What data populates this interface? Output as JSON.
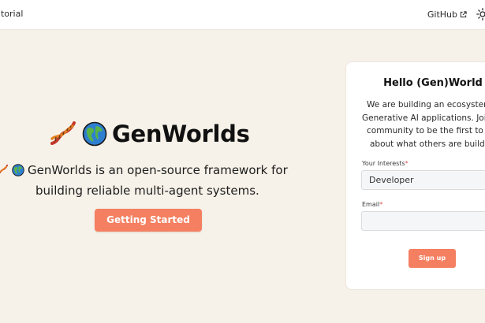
{
  "nav": {
    "left_link": "utorial",
    "github_label": "GitHub",
    "icons": {
      "external": "external-link-icon",
      "theme": "sun-icon"
    }
  },
  "hero": {
    "title": "GenWorlds",
    "desc_line1": "GenWorlds is an open-source framework for",
    "desc_line2": "building reliable multi-agent systems.",
    "cta_label": "Getting Started",
    "icons": [
      "dna-icon",
      "globe-icon"
    ]
  },
  "card": {
    "title": "Hello (Gen)World",
    "text_lines": [
      "We are building an ecosystem",
      "Generative AI applications. Join",
      "community to be the first to lea",
      "about what others are buildin"
    ],
    "interests_label": "Your Interests",
    "interests_value": "Developer",
    "email_label": "Email",
    "email_value": "",
    "required_mark": "*",
    "signup_label": "Sign up"
  },
  "colors": {
    "background": "#f7f2e9",
    "accent": "#f58061",
    "card_bg": "#ffffff"
  }
}
